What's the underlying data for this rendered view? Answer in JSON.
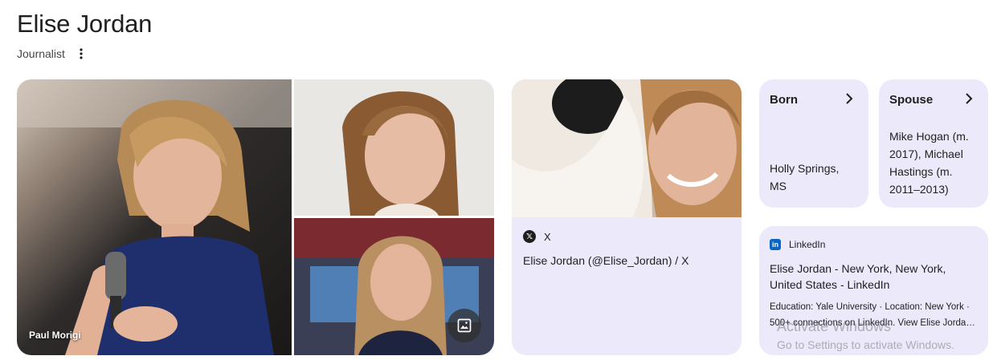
{
  "header": {
    "title": "Elise Jordan",
    "subtitle": "Journalist",
    "more_icon": "more-vert-icon"
  },
  "images": {
    "main_credit": "Paul Morigi",
    "view_images_icon": "image-icon"
  },
  "x_card": {
    "source": "X",
    "title": "Elise Jordan (@Elise_Jordan) / X",
    "logo_icon": "x-logo-icon"
  },
  "born_card": {
    "label": "Born",
    "value": "Holly Springs, MS"
  },
  "spouse_card": {
    "label": "Spouse",
    "value": "Mike Hogan (m. 2017), Michael Hastings (m. 2011–2013)"
  },
  "linkedin_card": {
    "source": "LinkedIn",
    "title": "Elise Jordan - New York, New York, United States - LinkedIn",
    "snippet": "Education: Yale University · Location: New York · 500+ connections on LinkedIn. View Elise Jordan's profile on LinkedIn"
  },
  "watermark": {
    "line1": "Activate Windows",
    "line2": "Go to Settings to activate Windows."
  },
  "colors": {
    "card_bg": "#ece9fb",
    "text": "#1f1f1f",
    "linkedin_blue": "#0a66c2"
  }
}
